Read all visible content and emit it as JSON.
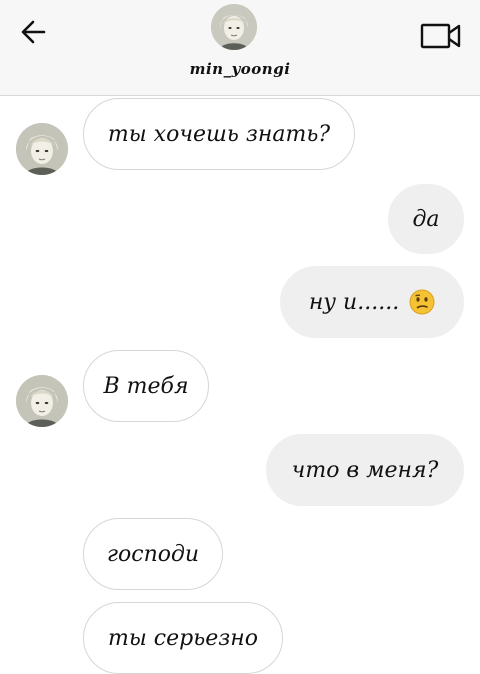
{
  "header": {
    "username": "min_yoongi",
    "back_icon": "arrow-left-icon",
    "video_icon": "video-camera-icon"
  },
  "messages": [
    {
      "side": "incoming",
      "text": "ты хочешь знать?"
    },
    {
      "side": "outgoing",
      "text": "да"
    },
    {
      "side": "outgoing",
      "text": "ну и......",
      "emoji": "confused-face"
    },
    {
      "side": "incoming",
      "text": "В тебя"
    },
    {
      "side": "outgoing",
      "text": "что в меня?"
    },
    {
      "side": "incoming",
      "text": "господи"
    },
    {
      "side": "incoming",
      "text": "ты серьезно"
    }
  ],
  "colors": {
    "incoming_bubble": "#ffffff",
    "outgoing_bubble": "#efefef",
    "header_bg": "#f7f7f7"
  }
}
